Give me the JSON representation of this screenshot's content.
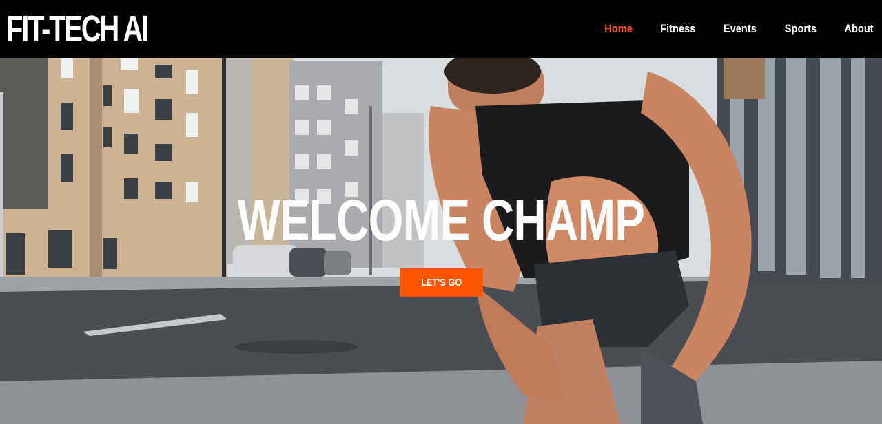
{
  "brand": {
    "name": "FIT-TECH AI"
  },
  "nav": {
    "items": [
      {
        "label": "Home",
        "active": true
      },
      {
        "label": "Fitness",
        "active": false
      },
      {
        "label": "Events",
        "active": false
      },
      {
        "label": "Sports",
        "active": false
      },
      {
        "label": "About",
        "active": false
      }
    ]
  },
  "hero": {
    "title": "WELCOME CHAMP",
    "cta_label": "LET'S GO",
    "image_subject": "athlete tying running shoe on city street"
  },
  "colors": {
    "navbar_bg": "#000000",
    "accent": "#ff5400",
    "active_link": "#ff5a1f",
    "text": "#ffffff"
  }
}
